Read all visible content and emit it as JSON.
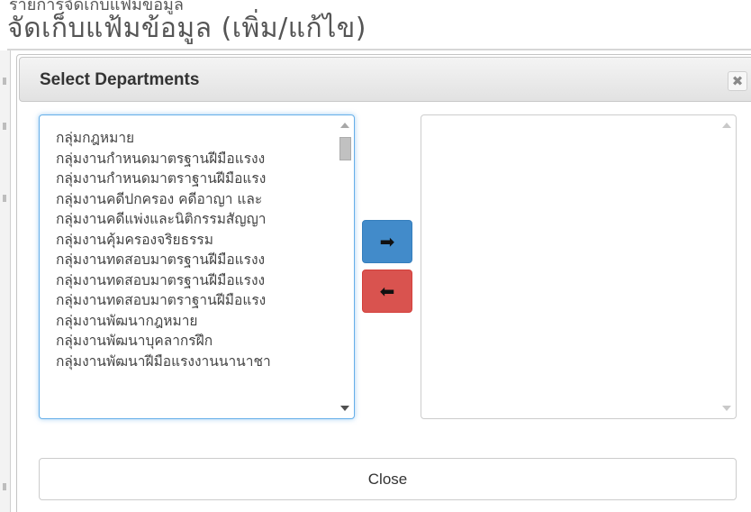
{
  "background": {
    "header_partial_top": "รายการจัดเก็บแฟ้มข้อมูล",
    "page_title_partial": "จัดเก็บแฟ้มข้อมูล (เพิ่ม/แก้ไข)"
  },
  "dialog": {
    "title": "Select Departments",
    "close_icon_glyph": "✖",
    "available_list": {
      "items": [
        "กลุ่มกฎหมาย",
        "กลุ่มงานกำหนดมาตรฐานฝีมือแรงง",
        "กลุ่มงานกำหนดมาตราฐานฝีมือแรง",
        "กลุ่มงานคดีปกครอง คดีอาญา และ",
        "กลุ่มงานคดีแพ่งและนิติกรรมสัญญา",
        "กลุ่มงานคุ้มครองจริยธรรม",
        "กลุ่มงานทดสอบมาตรฐานฝีมือแรงง",
        "กลุ่มงานทดสอบมาตรฐานฝีมือแรงง",
        "กลุ่มงานทดสอบมาตราฐานฝีมือแรง",
        "กลุ่มงานพัฒนากฎหมาย",
        "กลุ่มงานพัฒนาบุคลากรฝึก",
        "กลุ่มงานพัฒนาฝีมือแรงงานนานาชา"
      ]
    },
    "selected_list": {
      "items": []
    },
    "move_right_glyph": "➡",
    "move_left_glyph": "⬅",
    "close_button_label": "Close"
  },
  "colors": {
    "primary": "#428bca",
    "danger": "#d9534f",
    "focus": "#66afe9"
  }
}
